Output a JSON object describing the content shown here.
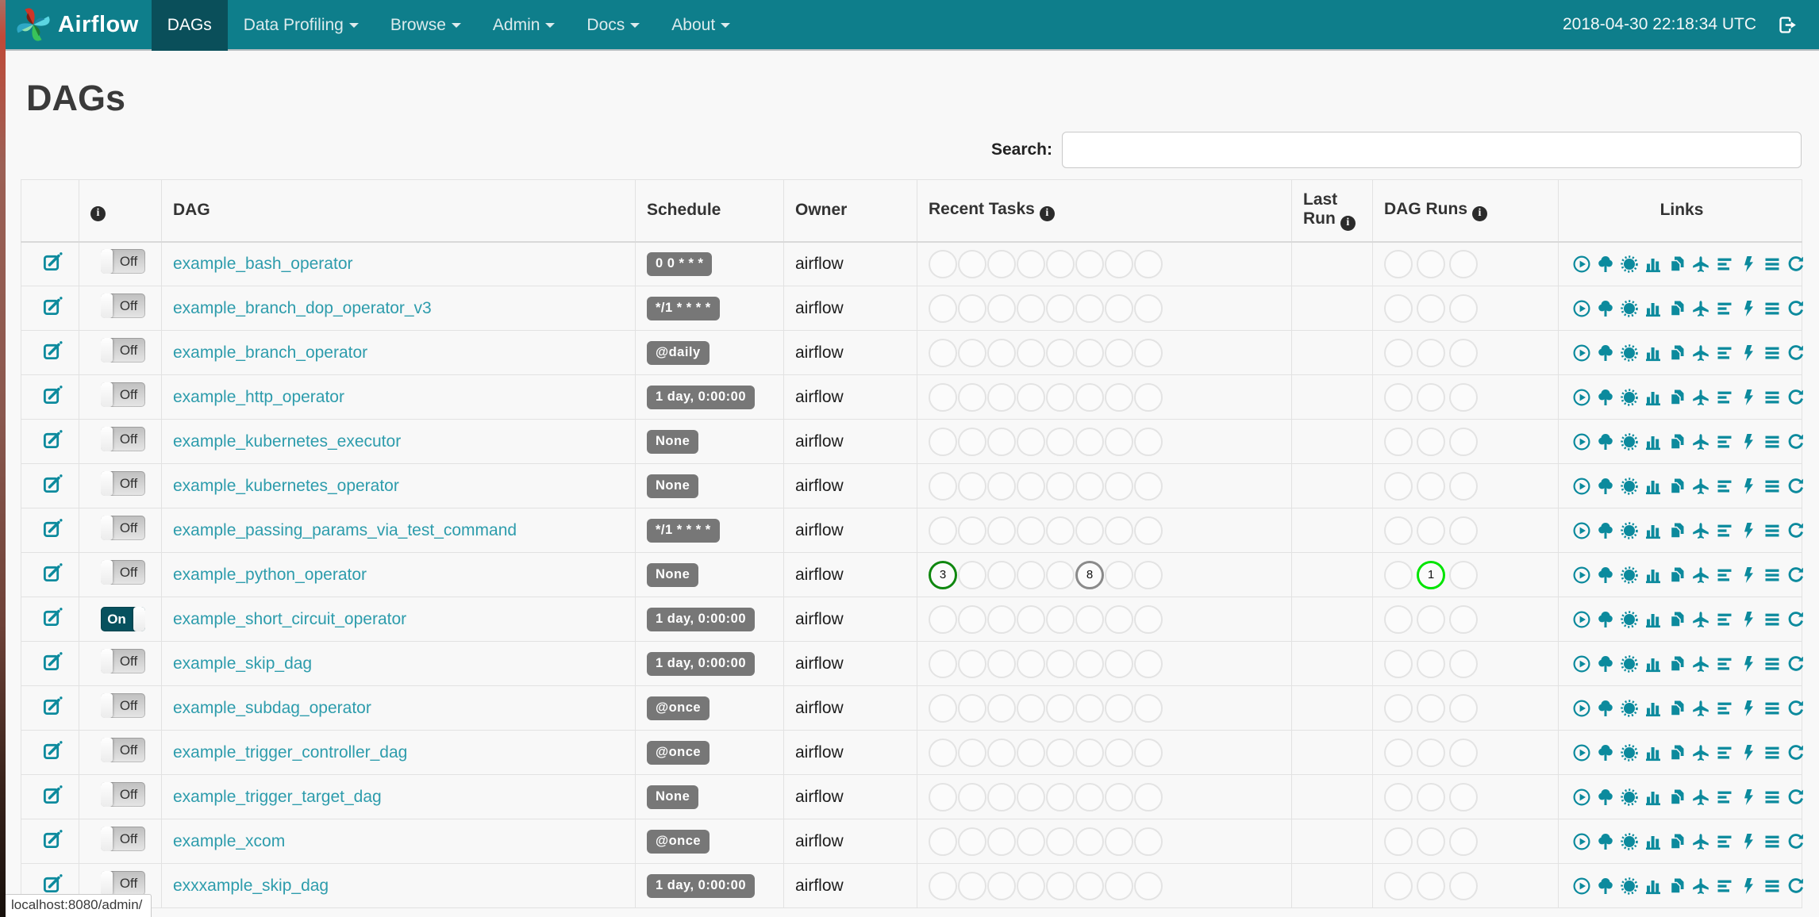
{
  "navbar": {
    "brand": "Airflow",
    "items": [
      {
        "label": "DAGs",
        "active": true,
        "caret": false
      },
      {
        "label": "Data Profiling",
        "active": false,
        "caret": true
      },
      {
        "label": "Browse",
        "active": false,
        "caret": true
      },
      {
        "label": "Admin",
        "active": false,
        "caret": true
      },
      {
        "label": "Docs",
        "active": false,
        "caret": true
      },
      {
        "label": "About",
        "active": false,
        "caret": true
      }
    ],
    "clock": "2018-04-30 22:18:34 UTC"
  },
  "page": {
    "title": "DAGs",
    "search_label": "Search:",
    "search_value": "",
    "status_bar": "localhost:8080/admin/"
  },
  "table": {
    "headers": {
      "dag": "DAG",
      "schedule": "Schedule",
      "owner": "Owner",
      "recent_tasks": "Recent Tasks",
      "last_run": "Last Run",
      "dag_runs": "DAG Runs",
      "links": "Links"
    },
    "recent_task_slots": 8,
    "dag_run_slots": 3,
    "rows": [
      {
        "name": "example_bash_operator",
        "toggle": "Off",
        "schedule": "0 0 * * *",
        "owner": "airflow",
        "last_run": "",
        "recent_tasks": [],
        "dag_runs": []
      },
      {
        "name": "example_branch_dop_operator_v3",
        "toggle": "Off",
        "schedule": "*/1 * * * *",
        "owner": "airflow",
        "last_run": "",
        "recent_tasks": [],
        "dag_runs": []
      },
      {
        "name": "example_branch_operator",
        "toggle": "Off",
        "schedule": "@daily",
        "owner": "airflow",
        "last_run": "",
        "recent_tasks": [],
        "dag_runs": []
      },
      {
        "name": "example_http_operator",
        "toggle": "Off",
        "schedule": "1 day, 0:00:00",
        "owner": "airflow",
        "last_run": "",
        "recent_tasks": [],
        "dag_runs": []
      },
      {
        "name": "example_kubernetes_executor",
        "toggle": "Off",
        "schedule": "None",
        "owner": "airflow",
        "last_run": "",
        "recent_tasks": [],
        "dag_runs": []
      },
      {
        "name": "example_kubernetes_operator",
        "toggle": "Off",
        "schedule": "None",
        "owner": "airflow",
        "last_run": "",
        "recent_tasks": [],
        "dag_runs": []
      },
      {
        "name": "example_passing_params_via_test_command",
        "toggle": "Off",
        "schedule": "*/1 * * * *",
        "owner": "airflow",
        "last_run": "",
        "recent_tasks": [],
        "dag_runs": []
      },
      {
        "name": "example_python_operator",
        "toggle": "Off",
        "schedule": "None",
        "owner": "airflow",
        "last_run": "",
        "recent_tasks": [
          {
            "slot": 0,
            "count": 3,
            "state": "success"
          },
          {
            "slot": 5,
            "count": 8,
            "state": "queued"
          }
        ],
        "dag_runs": [
          {
            "slot": 1,
            "count": 1,
            "state": "running"
          }
        ]
      },
      {
        "name": "example_short_circuit_operator",
        "toggle": "On",
        "schedule": "1 day, 0:00:00",
        "owner": "airflow",
        "last_run": "",
        "recent_tasks": [],
        "dag_runs": []
      },
      {
        "name": "example_skip_dag",
        "toggle": "Off",
        "schedule": "1 day, 0:00:00",
        "owner": "airflow",
        "last_run": "",
        "recent_tasks": [],
        "dag_runs": []
      },
      {
        "name": "example_subdag_operator",
        "toggle": "Off",
        "schedule": "@once",
        "owner": "airflow",
        "last_run": "",
        "recent_tasks": [],
        "dag_runs": []
      },
      {
        "name": "example_trigger_controller_dag",
        "toggle": "Off",
        "schedule": "@once",
        "owner": "airflow",
        "last_run": "",
        "recent_tasks": [],
        "dag_runs": []
      },
      {
        "name": "example_trigger_target_dag",
        "toggle": "Off",
        "schedule": "None",
        "owner": "airflow",
        "last_run": "",
        "recent_tasks": [],
        "dag_runs": []
      },
      {
        "name": "example_xcom",
        "toggle": "Off",
        "schedule": "@once",
        "owner": "airflow",
        "last_run": "",
        "recent_tasks": [],
        "dag_runs": []
      },
      {
        "name": "exxxample_skip_dag",
        "toggle": "Off",
        "schedule": "1 day, 0:00:00",
        "owner": "airflow",
        "last_run": "",
        "recent_tasks": [],
        "dag_runs": []
      }
    ]
  },
  "links": {
    "icons": [
      "trigger-dag",
      "tree-view",
      "graph-view",
      "task-duration",
      "task-tries",
      "landing-times",
      "gantt-view",
      "code-view",
      "logs",
      "refresh"
    ]
  },
  "colors": {
    "navbar": "#0e7e8b",
    "navbar_active": "#0a4f5a",
    "link_teal": "#2d9cac",
    "icon_teal": "#0c8a9d",
    "badge_gray": "#777777",
    "states": {
      "success": "#0f870f",
      "running": "#00e400",
      "queued": "#8a8a8a"
    }
  }
}
